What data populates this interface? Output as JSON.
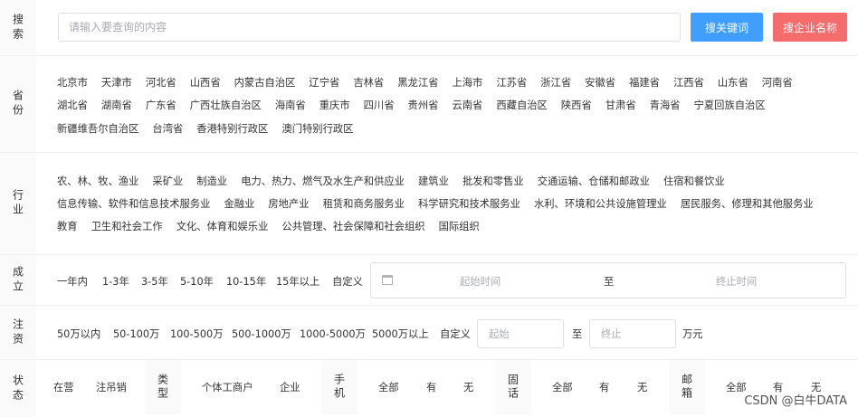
{
  "search": {
    "label": "搜索",
    "placeholder": "请输入要查询的内容",
    "btn_keyword": "搜关键词",
    "btn_company": "搜企业名称"
  },
  "province": {
    "label": "省份",
    "rows": [
      [
        "北京市",
        "天津市",
        "河北省",
        "山西省",
        "内蒙古自治区",
        "辽宁省",
        "吉林省",
        "黑龙江省",
        "上海市",
        "江苏省",
        "浙江省",
        "安徽省",
        "福建省",
        "江西省",
        "山东省",
        "河南省"
      ],
      [
        "湖北省",
        "湖南省",
        "广东省",
        "广西壮族自治区",
        "海南省",
        "重庆市",
        "四川省",
        "贵州省",
        "云南省",
        "西藏自治区",
        "陕西省",
        "甘肃省",
        "青海省",
        "宁夏回族自治区"
      ],
      [
        "新疆维吾尔自治区",
        "台湾省",
        "香港特别行政区",
        "澳门特别行政区"
      ]
    ]
  },
  "industry": {
    "label": "行业",
    "rows": [
      [
        "农、林、牧、渔业",
        "采矿业",
        "制造业",
        "电力、热力、燃气及水生产和供应业",
        "建筑业",
        "批发和零售业",
        "交通运输、仓储和邮政业",
        "住宿和餐饮业"
      ],
      [
        "信息传输、软件和信息技术服务业",
        "金融业",
        "房地产业",
        "租赁和商务服务业",
        "科学研究和技术服务业",
        "水利、环境和公共设施管理业",
        "居民服务、修理和其他服务业"
      ],
      [
        "教育",
        "卫生和社会工作",
        "文化、体育和娱乐业",
        "公共管理、社会保障和社会组织",
        "国际组织"
      ]
    ]
  },
  "establish": {
    "label": "成立",
    "options": [
      "一年内",
      "1-3年",
      "3-5年",
      "5-10年",
      "10-15年",
      "15年以上",
      "自定义"
    ],
    "start_placeholder": "起始时间",
    "to": "至",
    "end_placeholder": "终止时间"
  },
  "capital": {
    "label": "注资",
    "options": [
      "50万以内",
      "50-100万",
      "100-500万",
      "500-1000万",
      "1000-5000万",
      "5000万以上",
      "自定义"
    ],
    "start_placeholder": "起始",
    "to": "至",
    "end_placeholder": "终止",
    "unit": "万元"
  },
  "status": {
    "label": "状态",
    "options": [
      "在营",
      "注吊销"
    ],
    "type_label": "类型",
    "type_options": [
      "个体工商户",
      "企业"
    ],
    "phone_label": "手机",
    "phone_options": [
      "全部",
      "有",
      "无"
    ],
    "landline_label": "固话",
    "landline_options": [
      "全部",
      "有",
      "无"
    ],
    "email_label": "邮箱",
    "email_options": [
      "全部",
      "有",
      "无"
    ]
  },
  "watermark": "CSDN @白牛DATA"
}
